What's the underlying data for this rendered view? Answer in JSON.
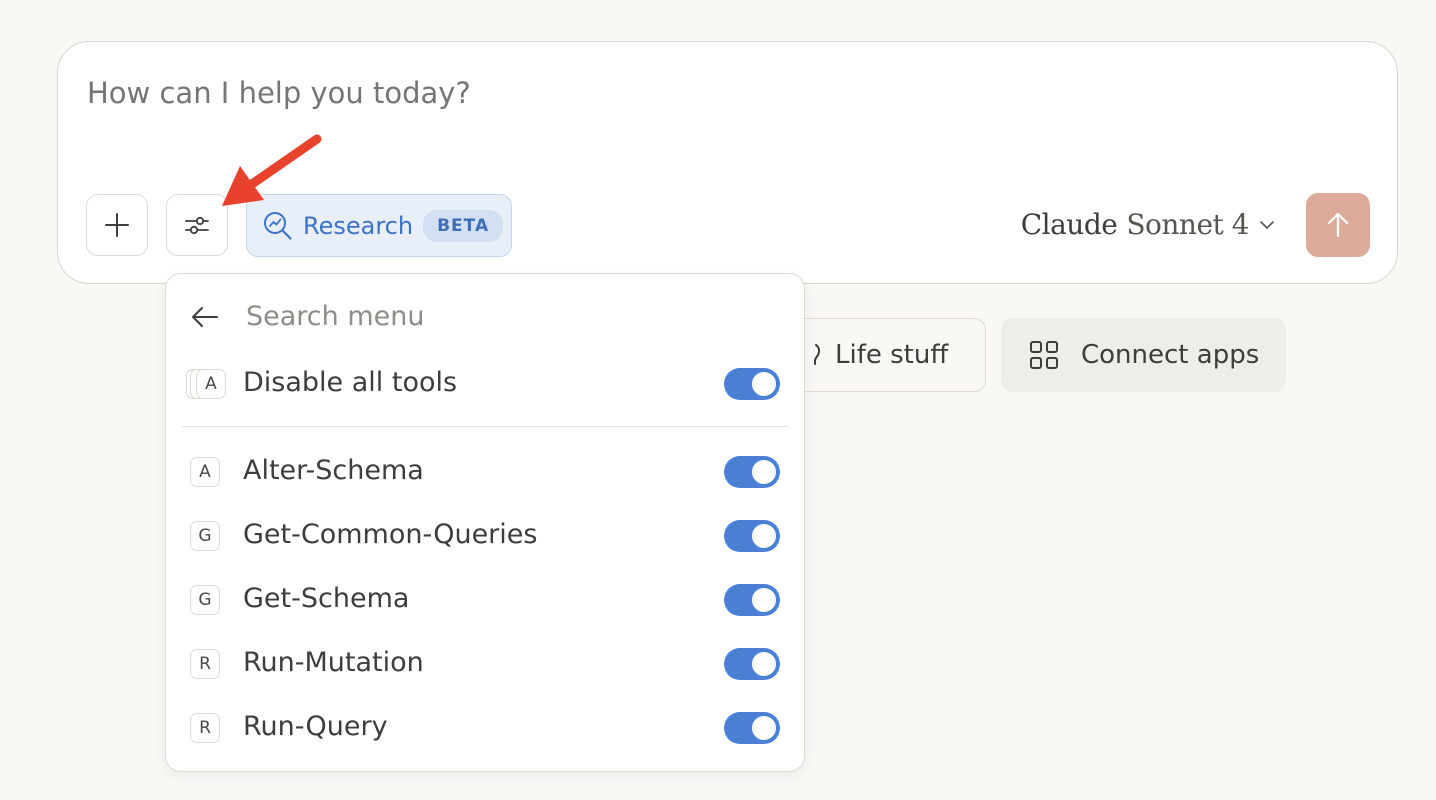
{
  "composer": {
    "placeholder": "How can I help you today?",
    "research": {
      "label": "Research",
      "badge": "BETA"
    },
    "model": {
      "name": "Claude",
      "version": "Sonnet 4"
    }
  },
  "chips": {
    "life_stuff": "Life stuff",
    "connect_apps": "Connect apps"
  },
  "tools_menu": {
    "search_placeholder": "Search menu",
    "disable_all": {
      "letter": "A",
      "label": "Disable all tools",
      "enabled": true
    },
    "items": [
      {
        "letter": "A",
        "label": "Alter-Schema",
        "enabled": true
      },
      {
        "letter": "G",
        "label": "Get-Common-Queries",
        "enabled": true
      },
      {
        "letter": "G",
        "label": "Get-Schema",
        "enabled": true
      },
      {
        "letter": "R",
        "label": "Run-Mutation",
        "enabled": true
      },
      {
        "letter": "R",
        "label": "Run-Query",
        "enabled": true
      }
    ]
  },
  "colors": {
    "accent_blue": "#4a80d4",
    "send_button": "#ddab99",
    "annotation_arrow": "#e8422c"
  },
  "icons": [
    "plus-icon",
    "sliders-icon",
    "research-icon",
    "chevron-down-icon",
    "arrow-up-icon",
    "back-arrow-icon",
    "grid-icon",
    "lightbulb-icon"
  ]
}
